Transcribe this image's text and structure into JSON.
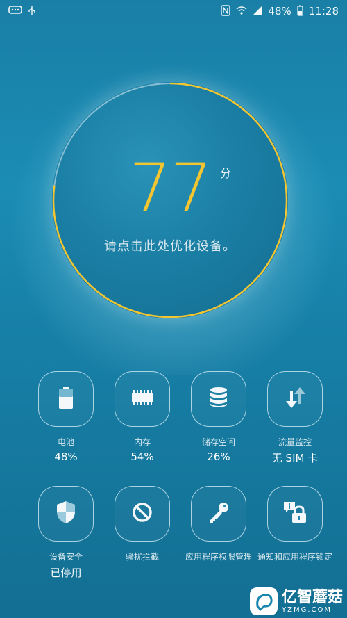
{
  "status_bar": {
    "left_icons": [
      "message-icon",
      "usb-icon"
    ],
    "right_icons": [
      "nfc-icon",
      "wifi-icon",
      "signal-icon"
    ],
    "battery": "48%",
    "time": "11:28"
  },
  "score": {
    "value": "77",
    "unit": "分",
    "progress": 0.77,
    "hint": "请点击此处优化设备。",
    "ring_color": "#f2c531"
  },
  "tiles": [
    {
      "label": "电池",
      "value": "48%",
      "icon": "battery-icon"
    },
    {
      "label": "内存",
      "value": "54%",
      "icon": "memory-chip-icon"
    },
    {
      "label": "储存空间",
      "value": "26%",
      "icon": "storage-database-icon"
    },
    {
      "label": "流量监控",
      "value": "无 SIM 卡",
      "icon": "data-arrows-icon"
    },
    {
      "label": "设备安全",
      "value": "已停用",
      "icon": "shield-icon"
    },
    {
      "label": "骚扰拦截",
      "value": "",
      "icon": "block-icon"
    },
    {
      "label": "应用程序权限管理",
      "value": "",
      "icon": "key-icon"
    },
    {
      "label": "通知和应用程序锁定",
      "value": "",
      "icon": "lock-notification-icon"
    }
  ],
  "watermark": {
    "title": "亿智蘑菇",
    "subtitle": "YZMG.COM"
  }
}
